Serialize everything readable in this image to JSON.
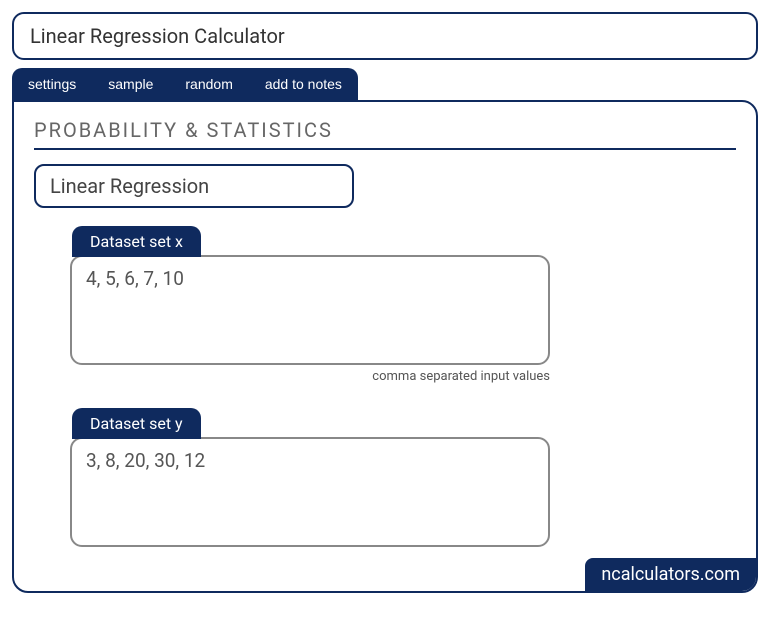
{
  "title": "Linear Regression Calculator",
  "tabs": {
    "settings": "settings",
    "sample": "sample",
    "random": "random",
    "add_to_notes": "add to notes"
  },
  "section": {
    "heading": "PROBABILITY & STATISTICS",
    "subtype": "Linear Regression"
  },
  "dataset_x": {
    "label": "Dataset set x",
    "value": "4, 5, 6, 7, 10",
    "hint": "comma separated input values"
  },
  "dataset_y": {
    "label": "Dataset set y",
    "value": "3, 8, 20, 30, 12"
  },
  "watermark": "ncalculators.com"
}
